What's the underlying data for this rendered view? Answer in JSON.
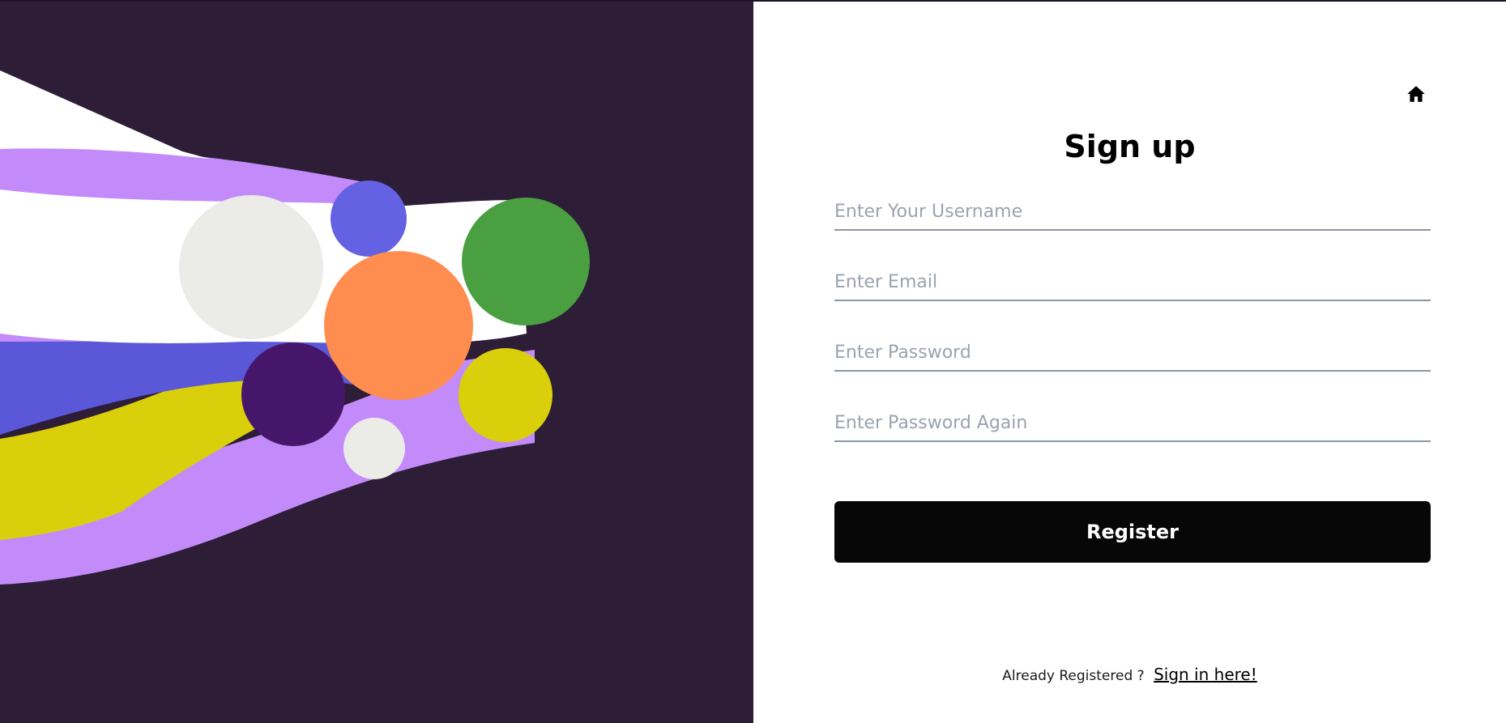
{
  "signup": {
    "title": "Sign up",
    "fields": {
      "username_placeholder": "Enter Your Username",
      "email_placeholder": "Enter Email",
      "password_placeholder": "Enter Password",
      "password_again_placeholder": "Enter Password Again"
    },
    "register_label": "Register",
    "already_registered_text": "Already Registered ?",
    "signin_link_label": "Sign in here!",
    "home_icon": "home-icon"
  },
  "colors": {
    "art_background": "#2d1d37",
    "button_background": "#070707",
    "field_underline": "#8d96a4",
    "placeholder": "#9aa3b0"
  }
}
